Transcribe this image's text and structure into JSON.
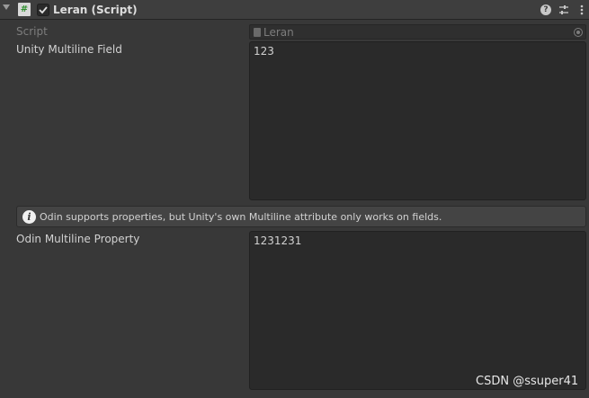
{
  "header": {
    "title": "Leran (Script)",
    "script_icon_glyph": "#",
    "enabled": true,
    "icons": [
      "foldout-arrow-icon",
      "script-icon",
      "help-icon",
      "preset-icon",
      "context-menu-icon"
    ]
  },
  "script_field": {
    "label": "Script",
    "value": "Leran"
  },
  "unity_multiline": {
    "label": "Unity Multiline Field",
    "value": "123"
  },
  "info_box": {
    "text": "Odin supports properties, but Unity's own Multiline attribute only works on fields.",
    "icon_glyph": "i"
  },
  "odin_multiline": {
    "label": "Odin Multiline Property",
    "value": "1231231"
  },
  "watermark": "CSDN @ssuper41",
  "colors": {
    "background": "#383838",
    "header": "#3e3e3e",
    "field": "#2a2a2a",
    "text": "#d2d2d2",
    "accent_green": "#2f8f2f"
  }
}
